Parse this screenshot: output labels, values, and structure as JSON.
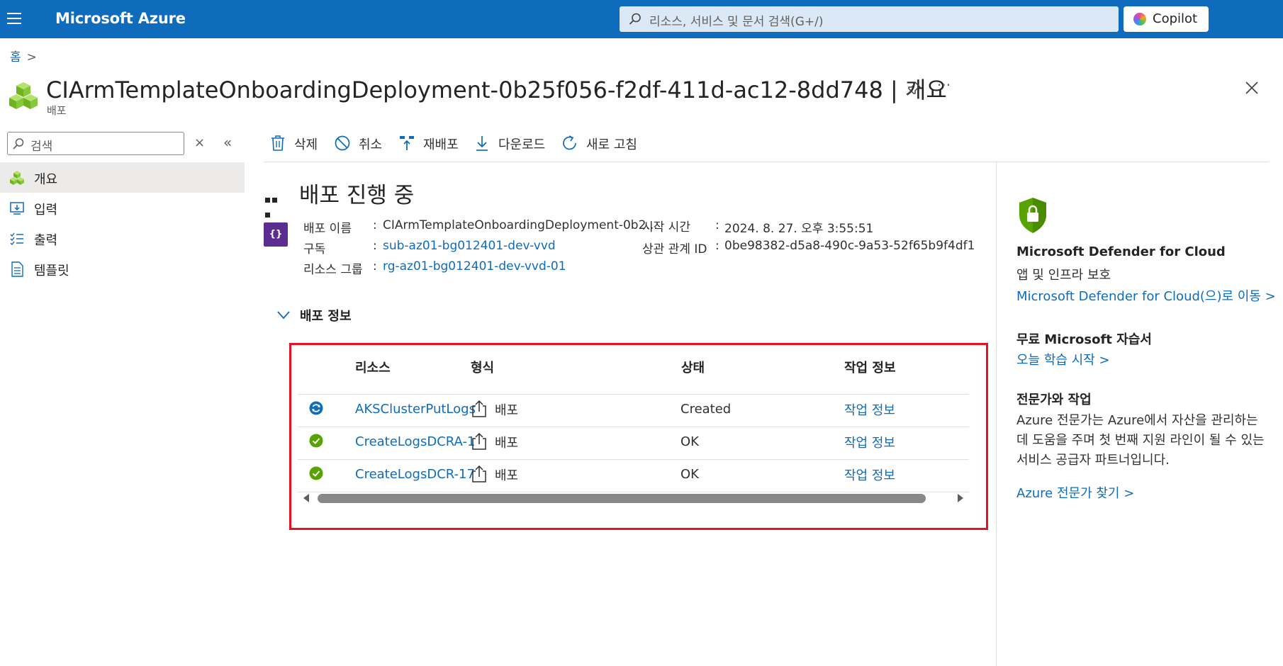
{
  "topbar": {
    "brand": "Microsoft Azure",
    "search_placeholder": "리소스, 서비스 및 문서 검색(G+/)",
    "copilot_label": "Copilot",
    "bar_color": "#0f6cbd"
  },
  "breadcrumb": {
    "home": "홈",
    "separator": ">"
  },
  "header": {
    "title": "CIArmTemplateOnboardingDeployment-0b25f056-f2df-411d-ac12-8dd748 | 개요",
    "subtitle": "배포",
    "more": "···"
  },
  "left_nav": {
    "search_placeholder": "검색",
    "clear_label": "×",
    "collapse_label": "«",
    "items": [
      {
        "label": "개요",
        "icon": "overview-cubes-icon",
        "active": true
      },
      {
        "label": "입력",
        "icon": "inputs-icon",
        "active": false
      },
      {
        "label": "출력",
        "icon": "outputs-icon",
        "active": false
      },
      {
        "label": "템플릿",
        "icon": "template-icon",
        "active": false
      }
    ]
  },
  "toolbar": {
    "delete": "삭제",
    "cancel": "취소",
    "redeploy": "재배포",
    "download": "다운로드",
    "refresh": "새로 고침"
  },
  "status": {
    "heading": "배포 진행 중"
  },
  "details": {
    "deployment_name_label": "배포 이름",
    "deployment_name_value": "CIArmTemplateOnboardingDeployment-0b2...",
    "subscription_label": "구독",
    "subscription_value": "sub-az01-bg012401-dev-vvd",
    "resource_group_label": "리소스 그룹",
    "resource_group_value": "rg-az01-bg012401-dev-vvd-01",
    "start_time_label": "시작 시간",
    "start_time_value": "2024. 8. 27. 오후 3:55:51",
    "correlation_label": "상관 관계 ID",
    "correlation_value": "0be98382-d5a8-490c-9a53-52f65b9f4df1",
    "separator": ":"
  },
  "deployment_details": {
    "section_title": "배포 정보",
    "columns": [
      "리소스",
      "형식",
      "상태",
      "작업 정보"
    ],
    "rows": [
      {
        "status_icon": "in-progress-icon",
        "resource": "AKSClusterPutLogs",
        "type": "배포",
        "state": "Created",
        "op": "작업 정보"
      },
      {
        "status_icon": "success-check-icon",
        "resource": "CreateLogsDCRA-1",
        "type": "배포",
        "state": "OK",
        "op": "작업 정보"
      },
      {
        "status_icon": "success-check-icon",
        "resource": "CreateLogsDCR-17",
        "type": "배포",
        "state": "OK",
        "op": "작업 정보"
      }
    ],
    "highlight_color": "#e81123"
  },
  "right_panel": {
    "defender_title": "Microsoft Defender for Cloud",
    "defender_subtitle": "앱 및 인프라 보호",
    "defender_link": "Microsoft Defender for Cloud(으)로 이동 >",
    "learn_title": "무료 Microsoft 자습서",
    "learn_link": "오늘 학습 시작 >",
    "expert_title": "전문가와 작업",
    "expert_text": "Azure 전문가는 Azure에서 자산을 관리하는 데 도움을 주며 첫 번째 지원 라인이 될 수 있는 서비스 공급자 파트너입니다.",
    "expert_link": "Azure 전문가 찾기 >"
  }
}
